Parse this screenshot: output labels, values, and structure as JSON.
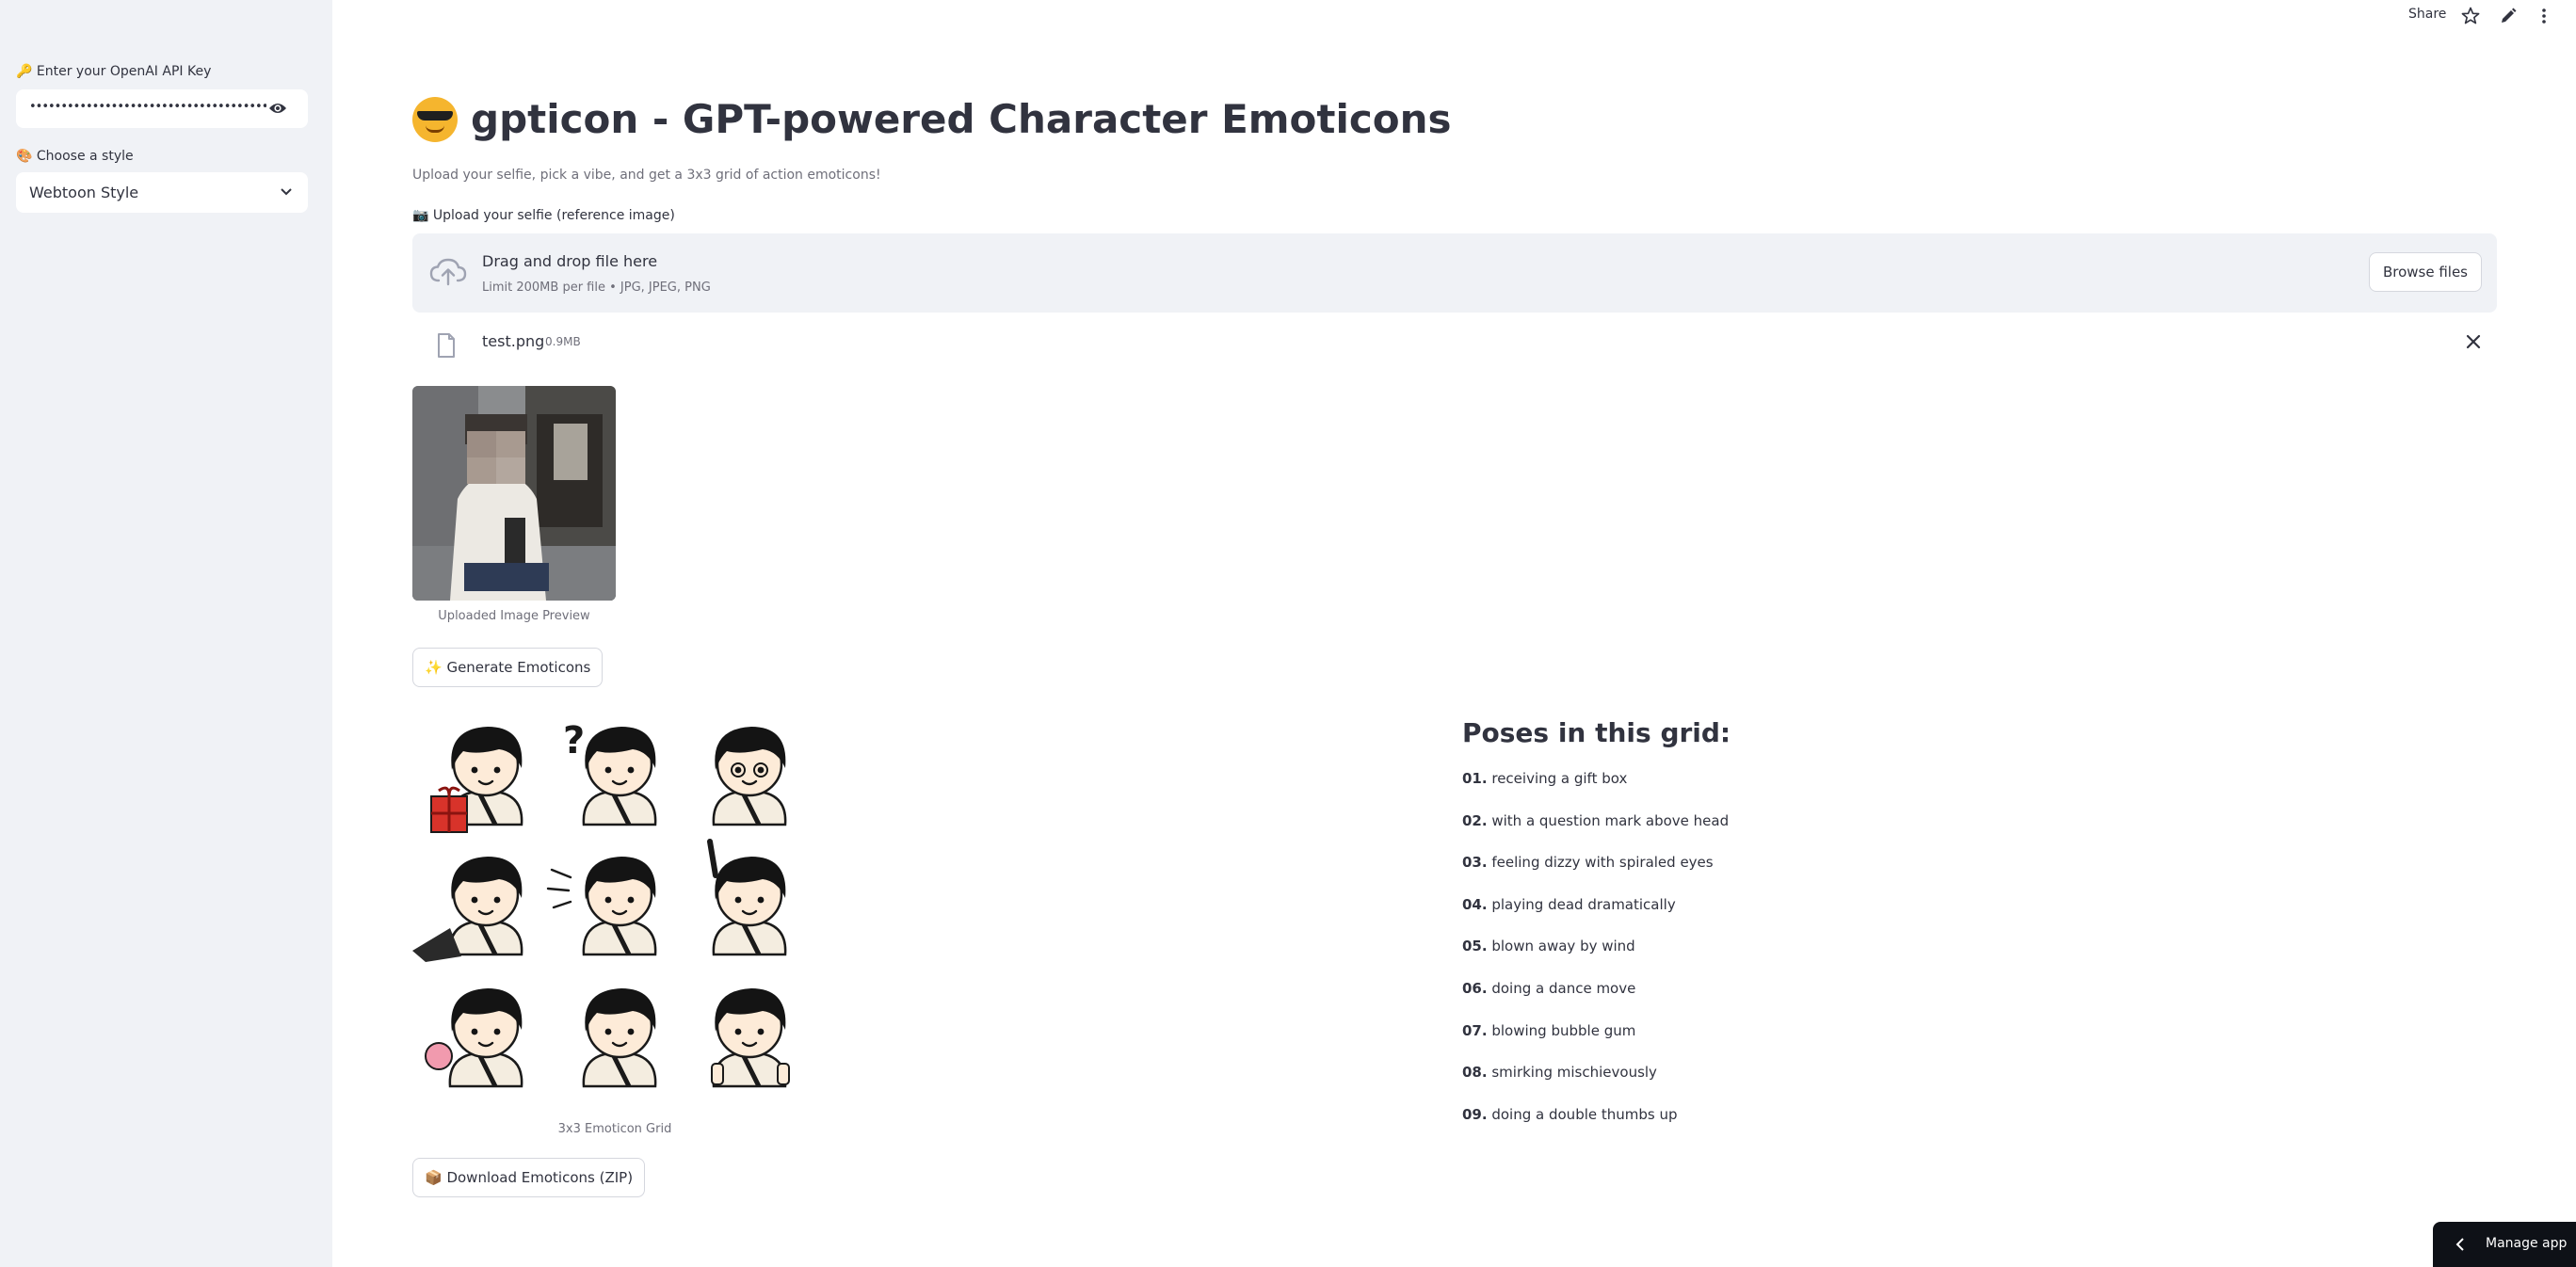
{
  "sidebar": {
    "api_key_label": "🔑 Enter your OpenAI API Key",
    "api_key_value": "•••••••••••••••••••••••••••••••••••••••••••••••••••••••••••••",
    "style_label": "🎨 Choose a style",
    "style_value": "Webtoon Style"
  },
  "topbar": {
    "share_label": "Share",
    "icons": [
      "star-icon",
      "pencil-icon",
      "more-vertical-icon"
    ]
  },
  "main": {
    "title": "gpticon - GPT-powered Character Emoticons",
    "subtitle": "Upload your selfie, pick a vibe, and get a 3x3 grid of action emoticons!",
    "upload_label": "📷 Upload your selfie (reference image)",
    "dropzone": {
      "title": "Drag and drop file here",
      "limit": "Limit 200MB per file • JPG, JPEG, PNG",
      "browse_label": "Browse files"
    },
    "file": {
      "name": "test.png",
      "size": "0.9MB"
    },
    "preview_caption": "Uploaded Image Preview",
    "generate_label": "✨ Generate Emoticons",
    "grid_caption": "3x3 Emoticon Grid",
    "download_label": "📦 Download Emoticons (ZIP)"
  },
  "poses": {
    "heading": "Poses in this grid:",
    "items": [
      {
        "num": "01.",
        "text": "receiving a gift box"
      },
      {
        "num": "02.",
        "text": "with a question mark above head"
      },
      {
        "num": "03.",
        "text": "feeling dizzy with spiraled eyes"
      },
      {
        "num": "04.",
        "text": "playing dead dramatically"
      },
      {
        "num": "05.",
        "text": "blown away by wind"
      },
      {
        "num": "06.",
        "text": "doing a dance move"
      },
      {
        "num": "07.",
        "text": "blowing bubble gum"
      },
      {
        "num": "08.",
        "text": "smirking mischievously"
      },
      {
        "num": "09.",
        "text": "doing a double thumbs up"
      }
    ]
  },
  "manage_app_label": "Manage app",
  "colors": {
    "sidebar_bg": "#f0f2f6",
    "text": "#31333f",
    "muted": "#6f6f7a",
    "dark": "#0e1117"
  }
}
